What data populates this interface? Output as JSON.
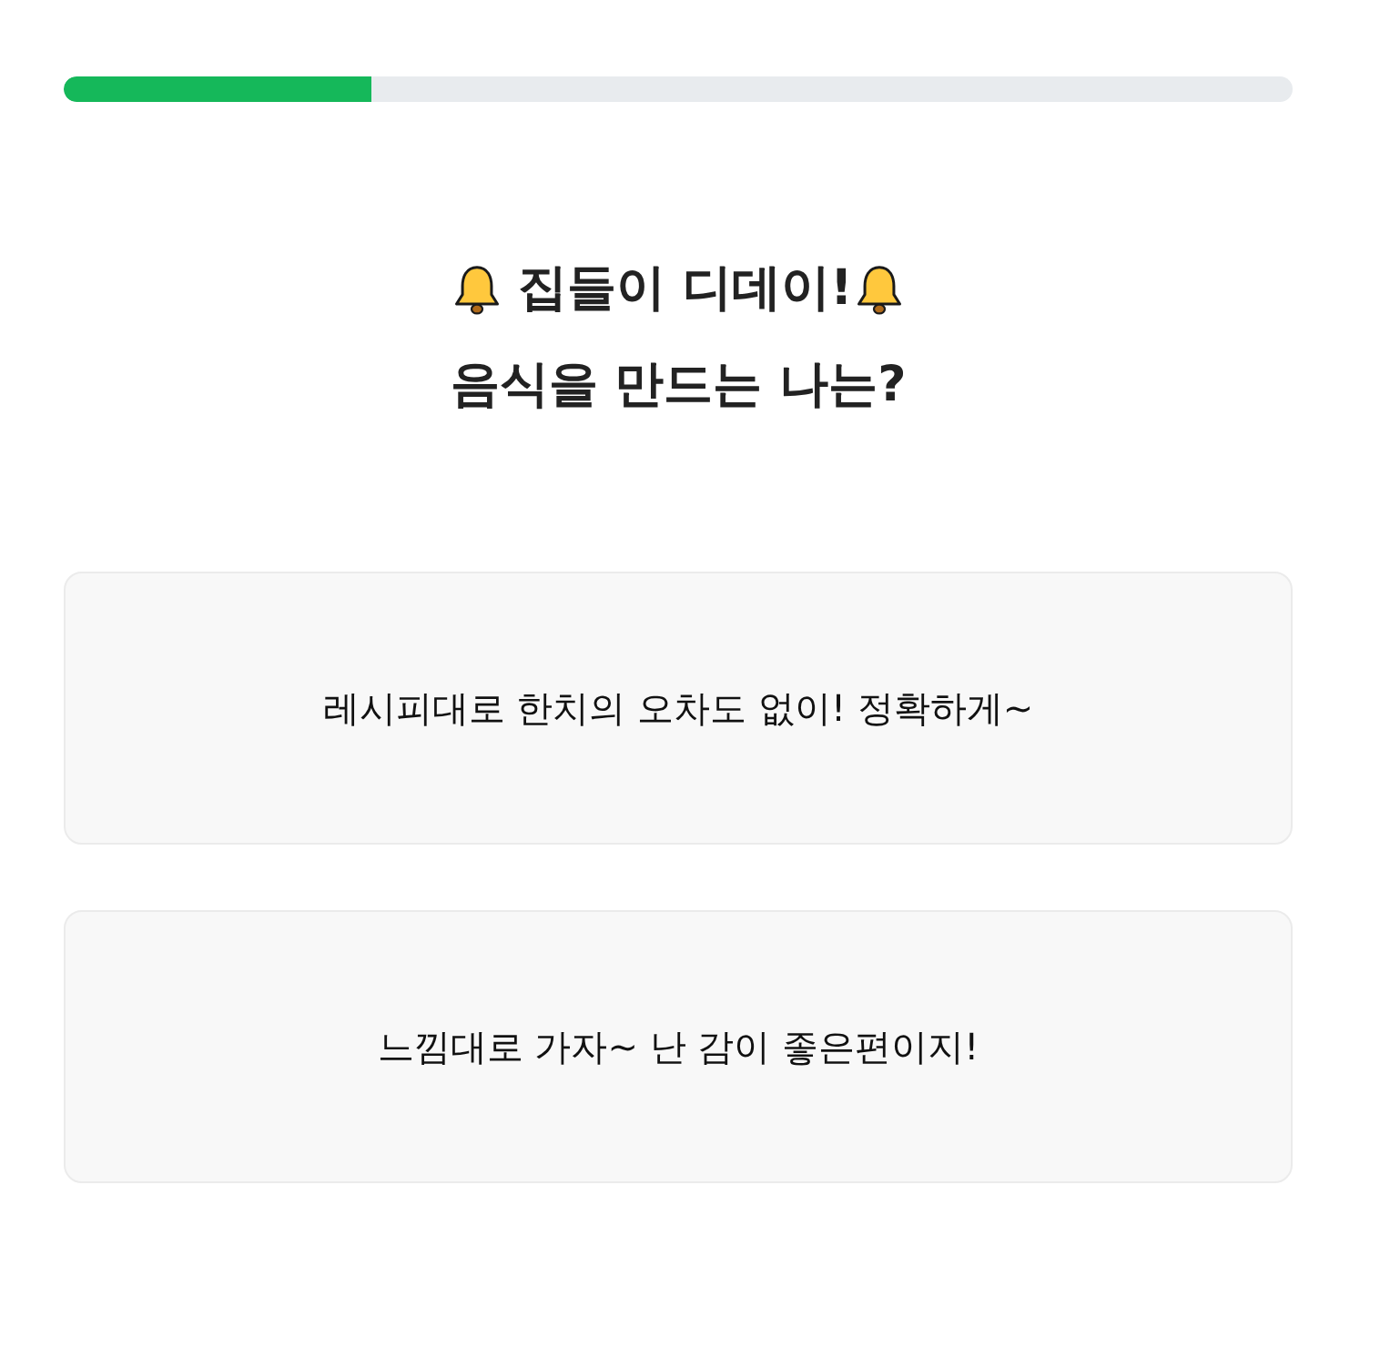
{
  "progress": {
    "level": 0.25
  },
  "question": {
    "title_line_1": "집들이 디데이!",
    "title_line_2": "음식을 만드는 나는?"
  },
  "options": [
    {
      "label": "레시피대로 한치의 오차도 없이! 정확하게~"
    },
    {
      "label": "느낌대로 가자~ 난 감이 좋은편이지!"
    }
  ]
}
